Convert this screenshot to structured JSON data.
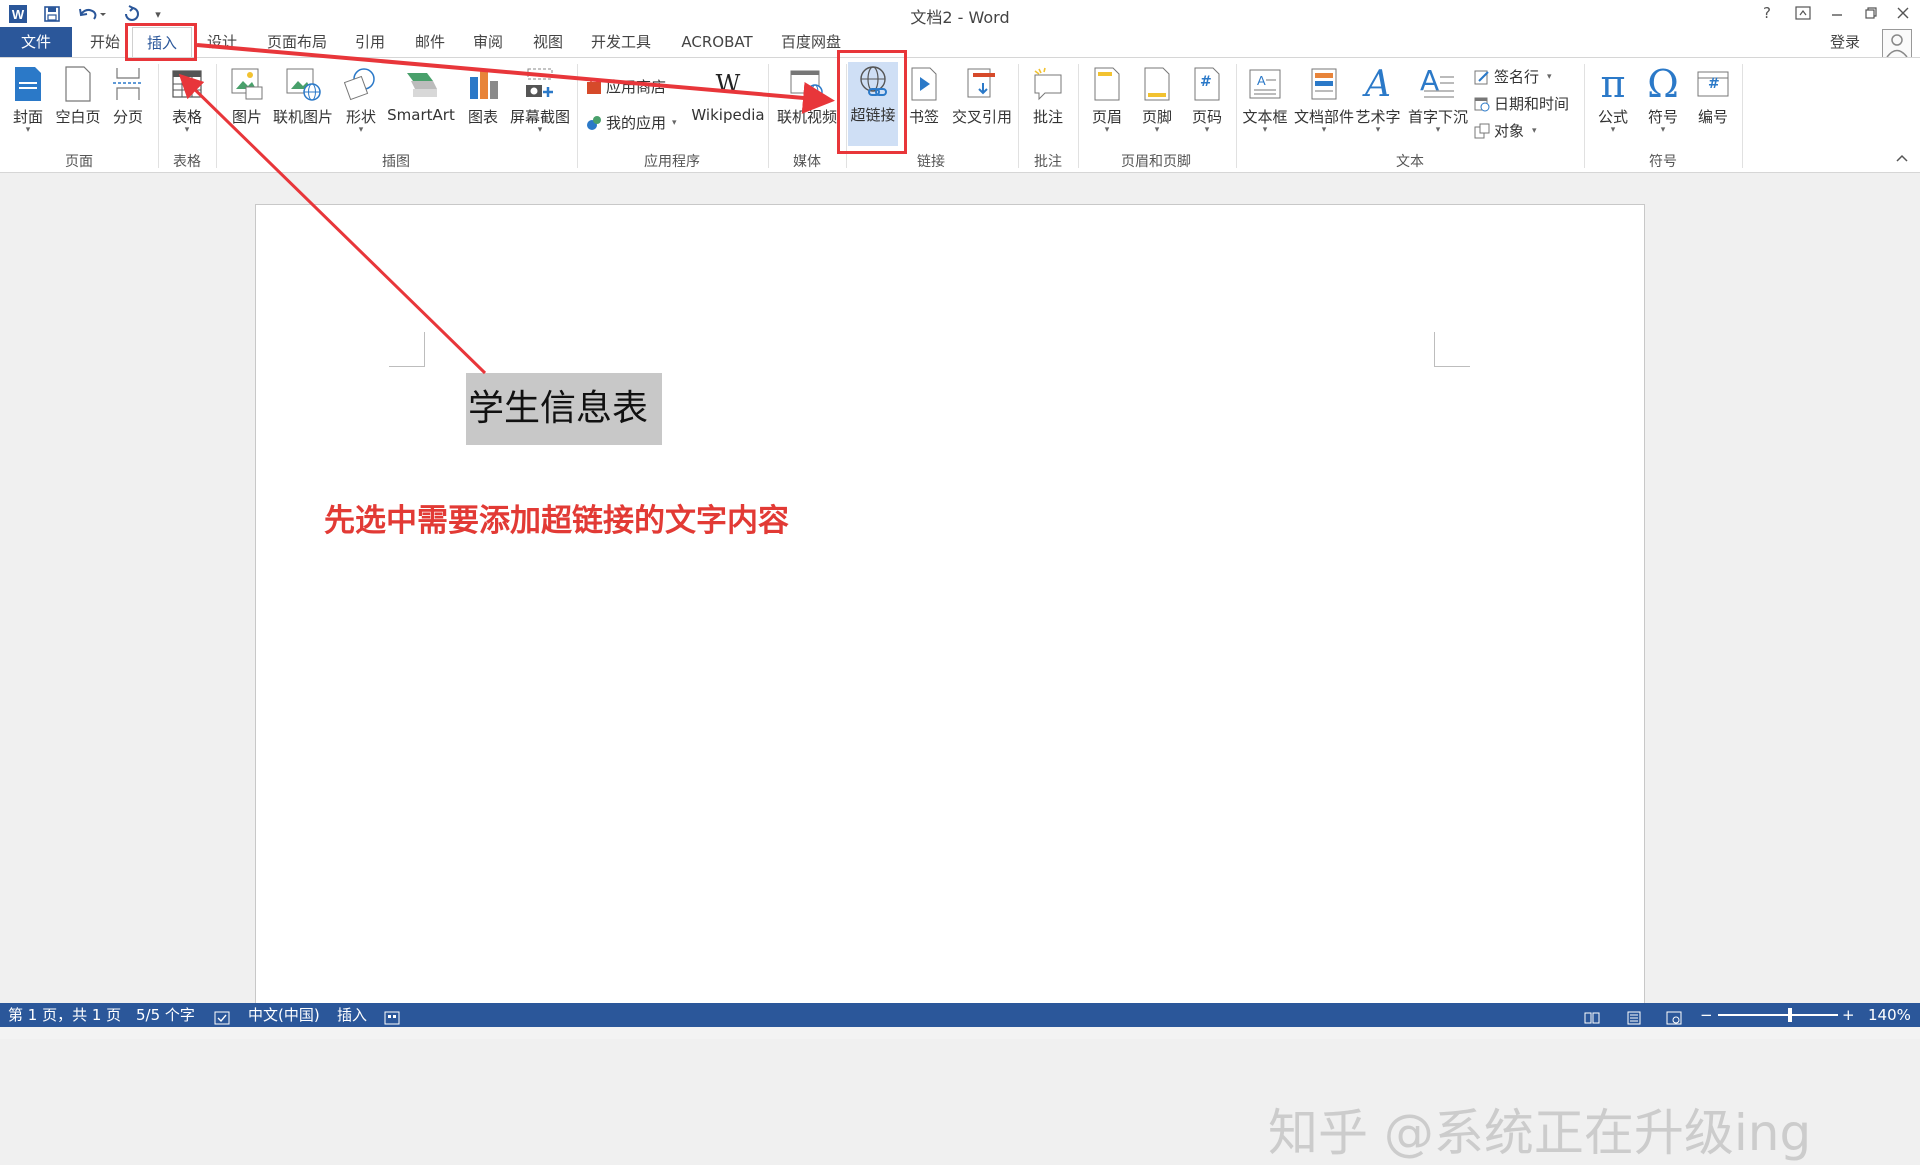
{
  "window": {
    "title": "文档2 - Word",
    "help": "?",
    "app_icon": "W",
    "quick_access_more": "▾"
  },
  "tabs": [
    {
      "label": "文件"
    },
    {
      "label": "开始"
    },
    {
      "label": "插入"
    },
    {
      "label": "设计"
    },
    {
      "label": "页面布局"
    },
    {
      "label": "引用"
    },
    {
      "label": "邮件"
    },
    {
      "label": "审阅"
    },
    {
      "label": "视图"
    },
    {
      "label": "开发工具"
    },
    {
      "label": "ACROBAT"
    },
    {
      "label": "百度网盘"
    }
  ],
  "account": {
    "login_label": "登录"
  },
  "ribbon": {
    "groups": {
      "pages": "页面",
      "tables": "表格",
      "illustrations": "插图",
      "apps": "应用程序",
      "media": "媒体",
      "links": "链接",
      "comments": "批注",
      "header_footer": "页眉和页脚",
      "text": "文本",
      "symbols": "符号"
    },
    "buttons": {
      "cover": "封面",
      "blank_page": "空白页",
      "page_break": "分页",
      "table": "表格",
      "picture": "图片",
      "online_picture": "联机图片",
      "shapes": "形状",
      "smartart": "SmartArt",
      "chart": "图表",
      "screenshot": "屏幕截图",
      "app_store": "应用商店",
      "my_apps": "我的应用",
      "wikipedia": "Wikipedia",
      "wikipedia_glyph": "W",
      "online_video": "联机视频",
      "hyperlink": "超链接",
      "bookmark": "书签",
      "cross_reference": "交叉引用",
      "comment": "批注",
      "header": "页眉",
      "footer": "页脚",
      "page_number": "页码",
      "text_box": "文本框",
      "quick_parts": "文档部件",
      "wordart": "艺术字",
      "drop_cap": "首字下沉",
      "signature_line": "签名行",
      "date_time": "日期和时间",
      "object": "对象",
      "equation": "公式",
      "symbol": "符号",
      "numbering": "编号",
      "equation_glyph": "π",
      "symbol_glyph": "Ω",
      "wordart_glyph": "A",
      "dropcap_glyph": "A",
      "page_number_glyph": "#",
      "numbering_glyph": "#"
    }
  },
  "document": {
    "title_text": "学生信息表",
    "annotation_text": "先选中需要添加超链接的文字内容"
  },
  "watermark": "知乎 @系统正在升级ing",
  "status": {
    "page_info": "第 1 页，共 1 页",
    "word_count": "5/5 个字",
    "language": "中文(中国)",
    "insert_mode": "插入",
    "zoom": "140%",
    "zoom_level": 0.6
  },
  "colors": {
    "accent": "#2b579a",
    "annotation": "#e8363a",
    "selection": "#c8c8c8"
  }
}
